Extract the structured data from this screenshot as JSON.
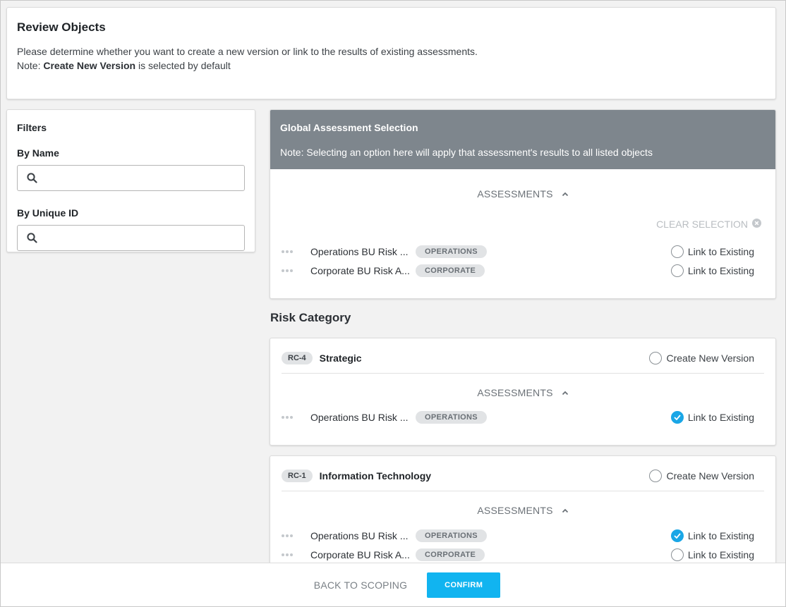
{
  "header": {
    "title": "Review Objects",
    "description": "Please determine whether you want to create a new version or link to the results of existing assessments.",
    "note_prefix": "Note: ",
    "note_bold": "Create New Version",
    "note_suffix": " is selected by default"
  },
  "filters": {
    "title": "Filters",
    "by_name_label": "By Name",
    "by_name_value": "",
    "by_id_label": "By Unique ID",
    "by_id_value": ""
  },
  "global": {
    "title": "Global Assessment Selection",
    "note": "Note: Selecting an option here will apply that assessment's results to all listed objects",
    "assessments_label": "ASSESSMENTS",
    "clear_label": "CLEAR SELECTION",
    "rows": [
      {
        "name": "Operations BU Risk ...",
        "tag": "OPERATIONS",
        "option": "Link to Existing",
        "checked": false
      },
      {
        "name": "Corporate BU Risk A...",
        "tag": "CORPORATE",
        "option": "Link to Existing",
        "checked": false
      }
    ]
  },
  "risk_category": {
    "title": "Risk Category",
    "items": [
      {
        "id": "RC-4",
        "name": "Strategic",
        "create_label": "Create New Version",
        "create_checked": false,
        "assessments_label": "ASSESSMENTS",
        "rows": [
          {
            "name": "Operations BU Risk ...",
            "tag": "OPERATIONS",
            "option": "Link to Existing",
            "checked": true
          }
        ]
      },
      {
        "id": "RC-1",
        "name": "Information Technology",
        "create_label": "Create New Version",
        "create_checked": false,
        "assessments_label": "ASSESSMENTS",
        "rows": [
          {
            "name": "Operations BU Risk ...",
            "tag": "OPERATIONS",
            "option": "Link to Existing",
            "checked": true
          },
          {
            "name": "Corporate BU Risk A...",
            "tag": "CORPORATE",
            "option": "Link to Existing",
            "checked": false
          }
        ]
      }
    ]
  },
  "footer": {
    "back_label": "BACK TO SCOPING",
    "confirm_label": "CONFIRM"
  },
  "colors": {
    "accent": "#11b4f0",
    "global_header_bg": "#7e868d"
  }
}
